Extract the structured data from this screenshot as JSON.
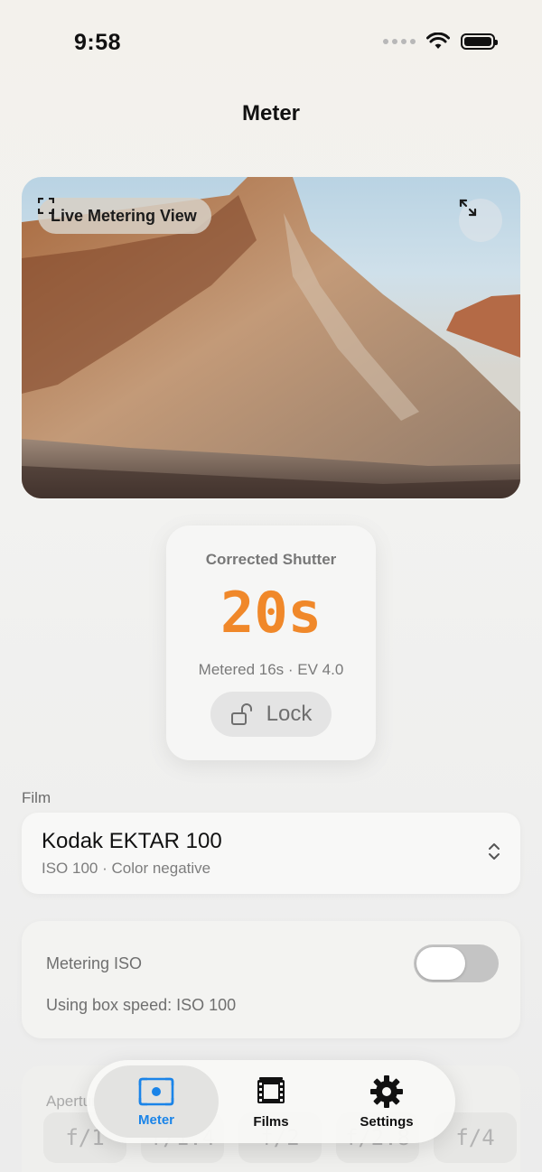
{
  "status_bar": {
    "time": "9:58"
  },
  "nav": {
    "title": "Meter"
  },
  "viewfinder": {
    "live_label": "Live Metering View",
    "icons": [
      "viewfinder-icon",
      "expand-icon"
    ]
  },
  "shutter": {
    "label": "Corrected Shutter",
    "value": "20s",
    "metered": "Metered 16s · EV 4.0",
    "lock_label": "Lock",
    "accent_color": "#f0882a"
  },
  "film": {
    "section_label": "Film",
    "name": "Kodak EKTAR 100",
    "details": "ISO 100 · Color negative"
  },
  "metering_iso": {
    "label": "Metering ISO",
    "toggle_on": false,
    "note": "Using box speed: ISO 100"
  },
  "aperture": {
    "label": "Aperture",
    "stops": [
      "f/1",
      "f/1.4",
      "f/2",
      "f/2.8",
      "f/4"
    ]
  },
  "tabbar": {
    "tabs": [
      {
        "label": "Meter",
        "icon": "meter-icon",
        "active": true
      },
      {
        "label": "Films",
        "icon": "film-icon",
        "active": false
      },
      {
        "label": "Settings",
        "icon": "gear-icon",
        "active": false
      }
    ],
    "active_color": "#1a84e8"
  }
}
